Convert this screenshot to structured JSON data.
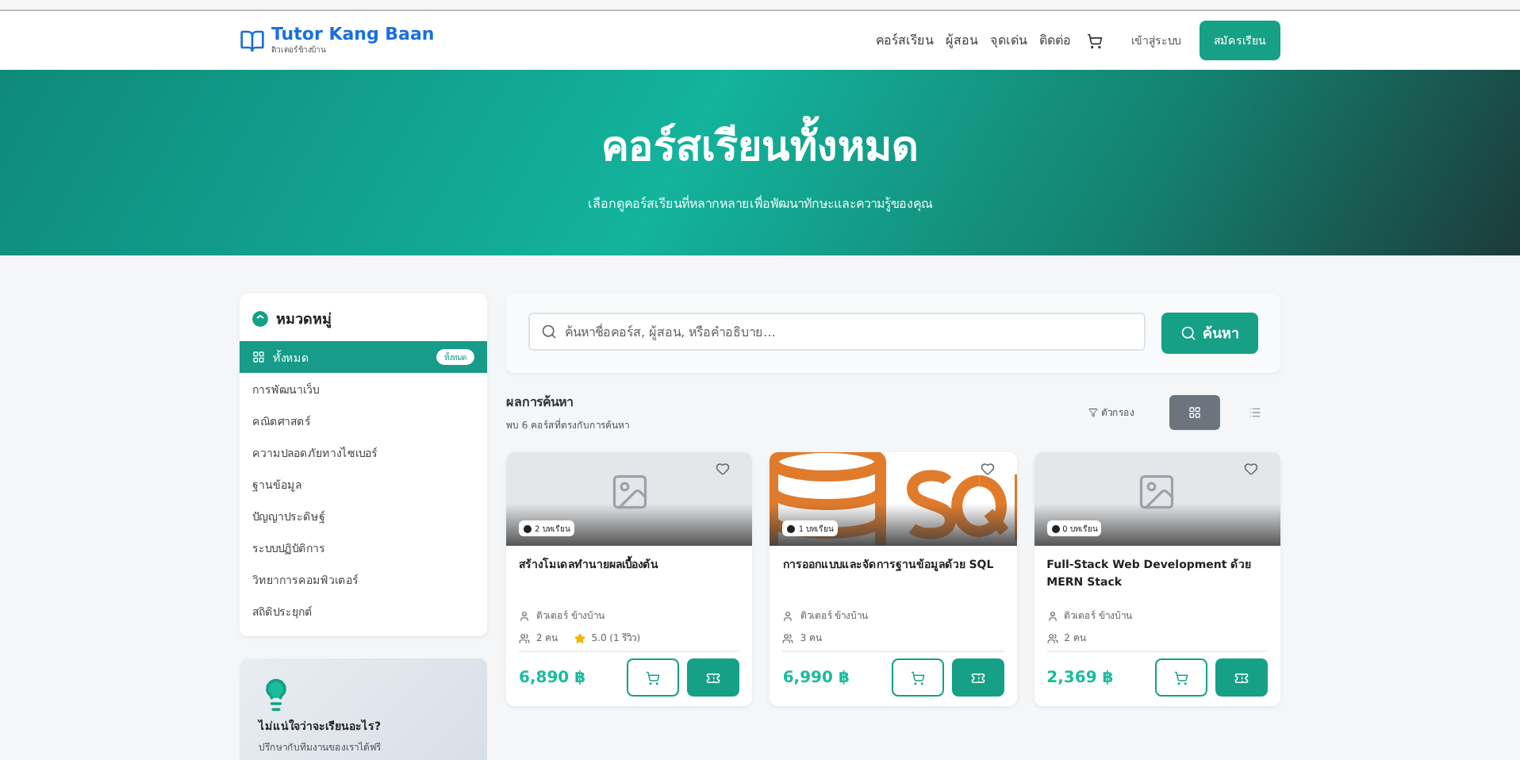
{
  "brand": {
    "name": "Tutor Kang Baan",
    "tagline": "ติวเตอร์ข้างบ้าน"
  },
  "nav": {
    "links": [
      "คอร์สเรียน",
      "ผู้สอน",
      "จุดเด่น",
      "ติดต่อ"
    ],
    "login": "เข้าสู่ระบบ",
    "signup": "สมัครเรียน"
  },
  "hero": {
    "title": "คอร์สเรียนทั้งหมด",
    "subtitle": "เลือกดูคอร์สเรียนที่หลากหลายเพื่อพัฒนาทักษะและความรู้ของคุณ"
  },
  "sidebar": {
    "title": "หมวดหมู่",
    "items": [
      {
        "label": "ทั้งหมด",
        "badge": "ทั้งหมด",
        "selected": true
      },
      {
        "label": "การพัฒนาเว็บ",
        "selected": false
      },
      {
        "label": "คณิตศาสตร์",
        "selected": false
      },
      {
        "label": "ความปลอดภัยทางไซเบอร์",
        "selected": false
      },
      {
        "label": "ฐานข้อมูล",
        "selected": false
      },
      {
        "label": "ปัญญาประดิษฐ์",
        "selected": false
      },
      {
        "label": "ระบบปฏิบัติการ",
        "selected": false
      },
      {
        "label": "วิทยาการคอมพิวเตอร์",
        "selected": false
      },
      {
        "label": "สถิติประยุกต์",
        "selected": false
      }
    ],
    "tip": {
      "title": "ไม่แน่ใจว่าจะเรียนอะไร?",
      "text": "ปรึกษากับทีมงานของเราได้ฟรี"
    }
  },
  "search": {
    "placeholder": "ค้นหาชื่อคอร์ส, ผู้สอน, หรือคำอธิบาย...",
    "button": "ค้นหา"
  },
  "results": {
    "title": "ผลการค้นหา",
    "count": "พบ 6 คอร์สที่ตรงกับการค้นหา",
    "filter": "ตัวกรอง",
    "views": [
      {
        "kind": "grid",
        "selected": true
      },
      {
        "kind": "list",
        "selected": false
      }
    ]
  },
  "courses": [
    {
      "kind": "placeholder",
      "lessons": "2 บทเรียน",
      "title": "สร้างโมเดลทำนายผลเบื้องต้น",
      "instructor": "ติวเตอร์ ข้างบ้าน",
      "students": "2 คน",
      "rating": "5.0 (1 รีวิว)",
      "price": "6,890 ฿"
    },
    {
      "kind": "sql",
      "lessons": "1 บทเรียน",
      "title": "การออกแบบและจัดการฐานข้อมูลด้วย SQL",
      "instructor": "ติวเตอร์ ข้างบ้าน",
      "students": "3 คน",
      "price": "6,990 ฿"
    },
    {
      "kind": "placeholder",
      "lessons": "0 บทเรียน",
      "title": "Full-Stack Web Development ด้วย MERN Stack",
      "instructor": "ติวเตอร์ ข้างบ้าน",
      "students": "2 คน",
      "price": "2,369 ฿"
    }
  ]
}
